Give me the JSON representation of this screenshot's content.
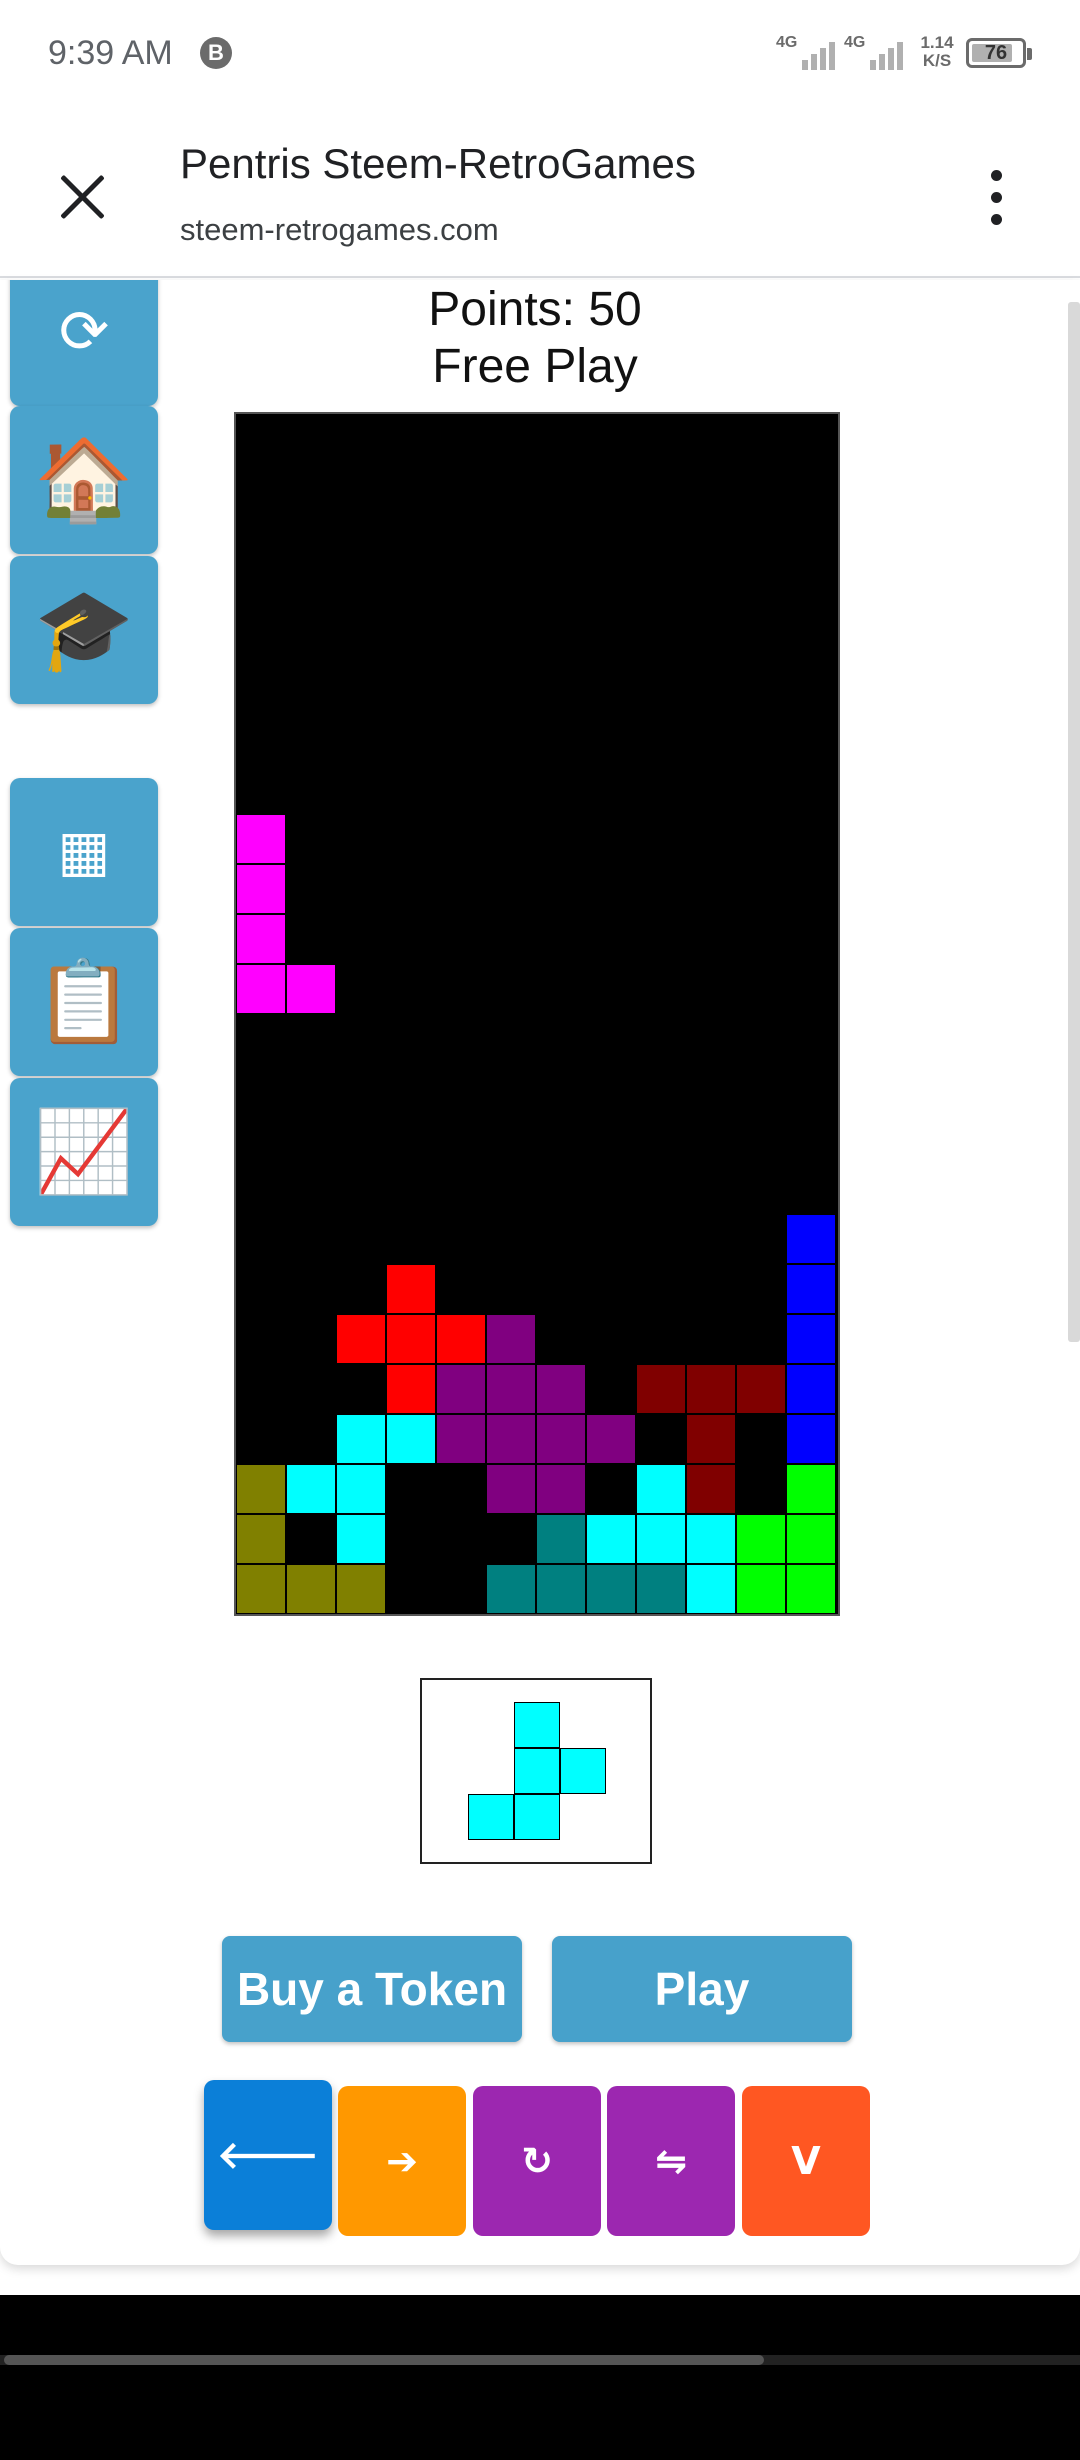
{
  "status_bar": {
    "time": "9:39 AM",
    "app_badge": "B",
    "net1": "4G",
    "net2": "4G",
    "speed_value": "1.14",
    "speed_unit": "K/S",
    "battery": "76"
  },
  "header": {
    "title": "Pentris Steem-RetroGames",
    "url": "steem-retrogames.com"
  },
  "sidebar": {
    "items": [
      {
        "name": "refresh-icon",
        "glyph": "⟳"
      },
      {
        "name": "house-icon",
        "glyph": "🏠"
      },
      {
        "name": "graduation-cap-icon",
        "glyph": "🎓"
      },
      {
        "name": "grid-icon",
        "glyph": "▦"
      },
      {
        "name": "clipboard-icon",
        "glyph": "📋"
      },
      {
        "name": "chart-increasing-icon",
        "glyph": "📈"
      }
    ]
  },
  "game": {
    "points": "Points: 50",
    "mode": "Free Play",
    "board": {
      "cols": 12,
      "rows": 24,
      "cells": [
        {
          "c": 0,
          "r": 8,
          "color": "#ff00ff"
        },
        {
          "c": 0,
          "r": 9,
          "color": "#ff00ff"
        },
        {
          "c": 0,
          "r": 10,
          "color": "#ff00ff"
        },
        {
          "c": 0,
          "r": 11,
          "color": "#ff00ff"
        },
        {
          "c": 1,
          "r": 11,
          "color": "#ff00ff"
        },
        {
          "c": 11,
          "r": 16,
          "color": "#0000ff"
        },
        {
          "c": 11,
          "r": 17,
          "color": "#0000ff"
        },
        {
          "c": 11,
          "r": 18,
          "color": "#0000ff"
        },
        {
          "c": 11,
          "r": 19,
          "color": "#0000ff"
        },
        {
          "c": 11,
          "r": 20,
          "color": "#0000ff"
        },
        {
          "c": 3,
          "r": 17,
          "color": "#ff0000"
        },
        {
          "c": 2,
          "r": 18,
          "color": "#ff0000"
        },
        {
          "c": 3,
          "r": 18,
          "color": "#ff0000"
        },
        {
          "c": 4,
          "r": 18,
          "color": "#ff0000"
        },
        {
          "c": 3,
          "r": 19,
          "color": "#ff0000"
        },
        {
          "c": 5,
          "r": 18,
          "color": "#800080"
        },
        {
          "c": 4,
          "r": 19,
          "color": "#800080"
        },
        {
          "c": 5,
          "r": 19,
          "color": "#800080"
        },
        {
          "c": 6,
          "r": 19,
          "color": "#800080"
        },
        {
          "c": 4,
          "r": 20,
          "color": "#800080"
        },
        {
          "c": 5,
          "r": 20,
          "color": "#800080"
        },
        {
          "c": 6,
          "r": 20,
          "color": "#800080"
        },
        {
          "c": 7,
          "r": 20,
          "color": "#800080"
        },
        {
          "c": 5,
          "r": 21,
          "color": "#800080"
        },
        {
          "c": 6,
          "r": 21,
          "color": "#800080"
        },
        {
          "c": 8,
          "r": 19,
          "color": "#800000"
        },
        {
          "c": 9,
          "r": 19,
          "color": "#800000"
        },
        {
          "c": 10,
          "r": 19,
          "color": "#800000"
        },
        {
          "c": 9,
          "r": 20,
          "color": "#800000"
        },
        {
          "c": 9,
          "r": 21,
          "color": "#800000"
        },
        {
          "c": 2,
          "r": 20,
          "color": "#00ffff"
        },
        {
          "c": 3,
          "r": 20,
          "color": "#00ffff"
        },
        {
          "c": 1,
          "r": 21,
          "color": "#00ffff"
        },
        {
          "c": 2,
          "r": 21,
          "color": "#00ffff"
        },
        {
          "c": 2,
          "r": 22,
          "color": "#00ffff"
        },
        {
          "c": 8,
          "r": 21,
          "color": "#00ffff"
        },
        {
          "c": 7,
          "r": 22,
          "color": "#00ffff"
        },
        {
          "c": 8,
          "r": 22,
          "color": "#00ffff"
        },
        {
          "c": 9,
          "r": 22,
          "color": "#00ffff"
        },
        {
          "c": 9,
          "r": 23,
          "color": "#00ffff"
        },
        {
          "c": 0,
          "r": 21,
          "color": "#808000"
        },
        {
          "c": 0,
          "r": 22,
          "color": "#808000"
        },
        {
          "c": 0,
          "r": 23,
          "color": "#808000"
        },
        {
          "c": 1,
          "r": 23,
          "color": "#808000"
        },
        {
          "c": 2,
          "r": 23,
          "color": "#808000"
        },
        {
          "c": 6,
          "r": 22,
          "color": "#008080"
        },
        {
          "c": 5,
          "r": 23,
          "color": "#008080"
        },
        {
          "c": 6,
          "r": 23,
          "color": "#008080"
        },
        {
          "c": 7,
          "r": 23,
          "color": "#008080"
        },
        {
          "c": 8,
          "r": 23,
          "color": "#008080"
        },
        {
          "c": 11,
          "r": 21,
          "color": "#00ff00"
        },
        {
          "c": 10,
          "r": 22,
          "color": "#00ff00"
        },
        {
          "c": 11,
          "r": 22,
          "color": "#00ff00"
        },
        {
          "c": 10,
          "r": 23,
          "color": "#00ff00"
        },
        {
          "c": 11,
          "r": 23,
          "color": "#00ff00"
        }
      ]
    },
    "next_piece": {
      "color": "#00ffff",
      "cells": [
        {
          "c": 1,
          "r": 0
        },
        {
          "c": 1,
          "r": 1
        },
        {
          "c": 2,
          "r": 1
        },
        {
          "c": 0,
          "r": 2
        },
        {
          "c": 1,
          "r": 2
        }
      ]
    }
  },
  "buttons": {
    "buy_token": "Buy a Token",
    "play": "Play"
  },
  "controls": [
    {
      "name": "left-arrow-button",
      "glyph": "🡐",
      "color": "#0b7fd8"
    },
    {
      "name": "right-arrow-button",
      "glyph": "➔",
      "color": "#ff9800"
    },
    {
      "name": "rotate-button",
      "glyph": "↻",
      "color": "#9c27b0"
    },
    {
      "name": "flip-button",
      "glyph": "⇋",
      "color": "#9c27b0"
    },
    {
      "name": "drop-button",
      "glyph": "V",
      "color": "#ff5722"
    }
  ]
}
